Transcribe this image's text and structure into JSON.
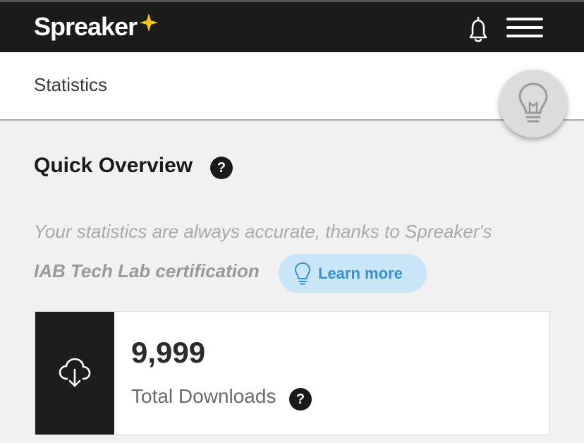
{
  "header": {
    "logo_text": "Spreaker",
    "brand_star_color": "#f5c518"
  },
  "subheader": {
    "title": "Statistics"
  },
  "overview": {
    "title": "Quick Overview",
    "help_mark": "?",
    "info_line1": "Your statistics are always accurate, thanks to Spreaker's",
    "info_line2": "IAB Tech Lab certification",
    "learn_more_label": "Learn more"
  },
  "stats": [
    {
      "value": "9,999",
      "label": "Total Downloads",
      "help_mark": "?",
      "icon": "cloud-download-icon"
    }
  ],
  "colors": {
    "topbar": "#1b1b1b",
    "learn_more_bg": "#c9e6f9",
    "learn_more_text": "#3b8fd0"
  }
}
